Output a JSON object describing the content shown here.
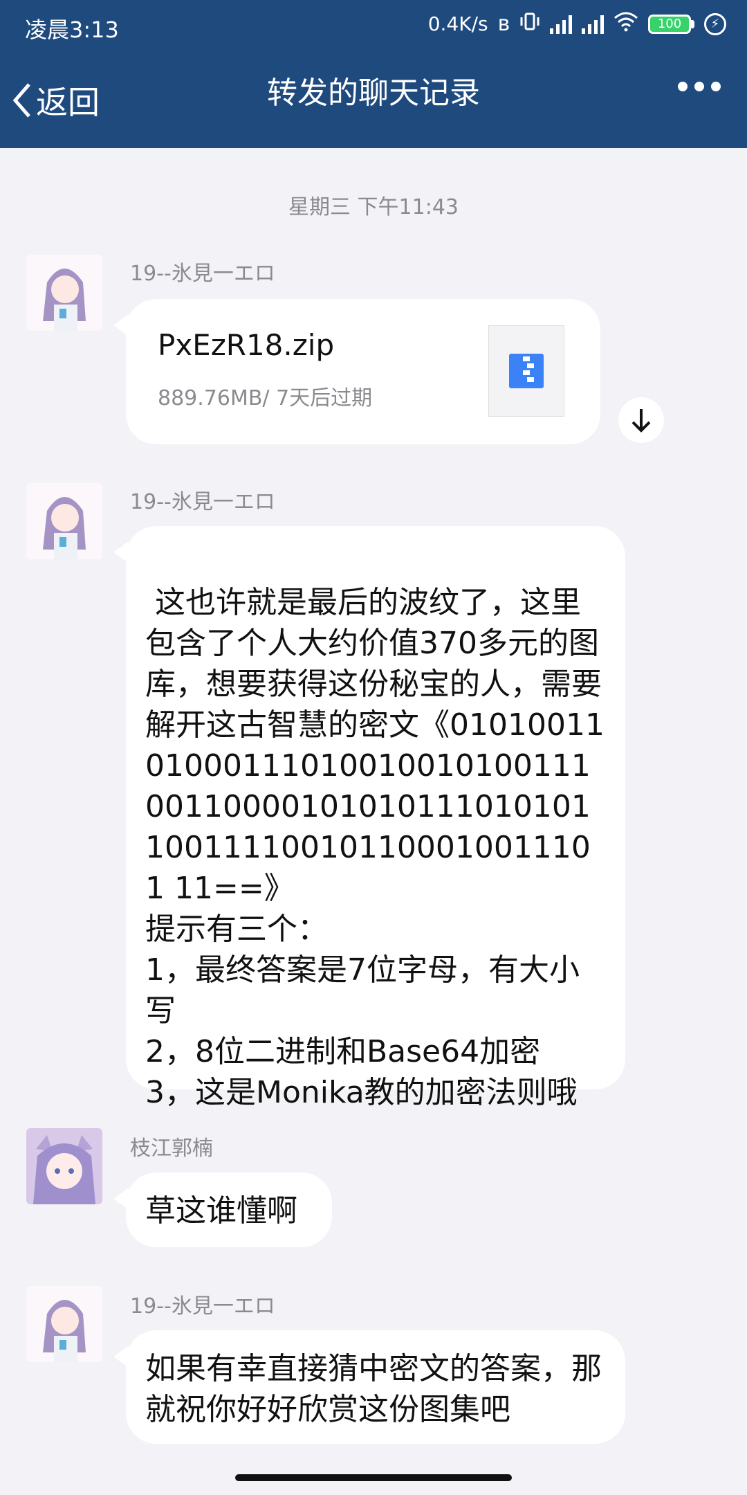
{
  "status_bar": {
    "time": "凌晨3:13",
    "network_speed": "0.4K/s",
    "battery": "100",
    "icons": [
      "bluetooth-icon",
      "vibrate-icon",
      "signal-icon",
      "signal-icon",
      "wifi-icon",
      "battery-icon",
      "charging-icon"
    ]
  },
  "header": {
    "back_label": "返回",
    "title": "转发的聊天记录",
    "bg_color": "#1f4a7e"
  },
  "date_separator": "星期三 下午11:43",
  "messages": [
    {
      "sender": "19--氷見一エロ",
      "type": "file",
      "file_name": "PxEzR18.zip",
      "file_meta": "889.76MB/ 7天后过期"
    },
    {
      "sender": "19--氷見一エロ",
      "type": "text",
      "text": "\n 这也许就是最后的波纹了，这里包含了个人大约价值370多元的图库，想要获得这份秘宝的人，需要解开这古智慧的密文《010100110100011101001001010011100110000101010111010101100111100101100010011101 11==》\n提示有三个：\n1，最终答案是7位字母，有大小写\n2，8位二进制和Base64加密\n3，这是Monika教的加密法则哦"
    },
    {
      "sender": "枝江郭楠",
      "type": "text",
      "text": "草这谁懂啊"
    },
    {
      "sender": "19--氷見一エロ",
      "type": "text",
      "text": "如果有幸直接猜中密文的答案，那就祝你好好欣赏这份图集吧"
    }
  ]
}
